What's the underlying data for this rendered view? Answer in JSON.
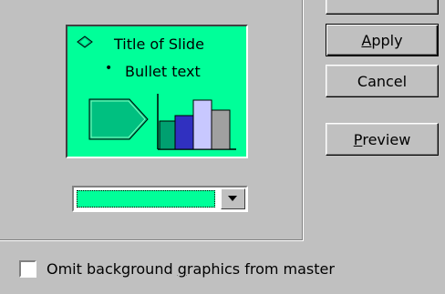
{
  "preview": {
    "slide_title": "Title of Slide",
    "bullet_text": "Bullet text",
    "bullet_symbol": "•",
    "background_color": "#00ff99"
  },
  "color_dropdown": {
    "selected_color": "#00ff99"
  },
  "buttons": {
    "apply": {
      "pre": "",
      "accel": "A",
      "post": "pply"
    },
    "cancel": {
      "label": "Cancel"
    },
    "preview": {
      "pre": "",
      "accel": "P",
      "post": "review"
    }
  },
  "checkbox": {
    "pre": "Omit background ",
    "accel": "g",
    "post": "raphics from master",
    "checked": false
  },
  "icons": [
    "diamond-icon",
    "arrow-shape-icon",
    "bar-chart-icon",
    "dropdown-arrow-icon"
  ],
  "colors": {
    "dialog_bg": "#c0c0c0",
    "slide_bg": "#00ff99",
    "arrow_fill": "#00c080",
    "bar_teal": "#00a070",
    "bar_blue": "#3030c0",
    "bar_lavender": "#c8c8ff",
    "bar_gray": "#a0a0a0"
  }
}
